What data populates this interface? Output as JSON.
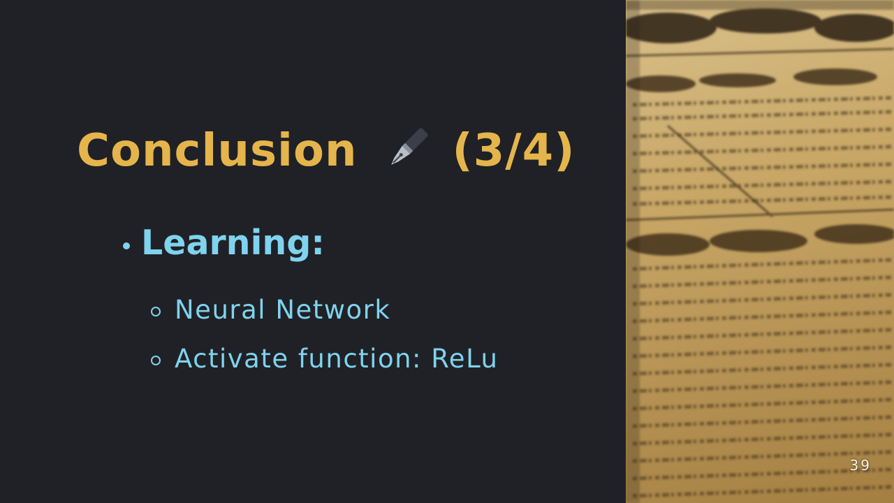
{
  "slide": {
    "title": "Conclusion",
    "title_icon": "fountain-pen-icon",
    "title_suffix": "(3/4)",
    "bullet": "Learning:",
    "subbullets": [
      "Neural Network",
      "Activate function: ReLu"
    ],
    "page_number": "39"
  },
  "colors": {
    "background": "#202126",
    "title": "#e5b54c",
    "text": "#7fd3ee"
  },
  "decor": {
    "image": "newspaper-photo"
  }
}
